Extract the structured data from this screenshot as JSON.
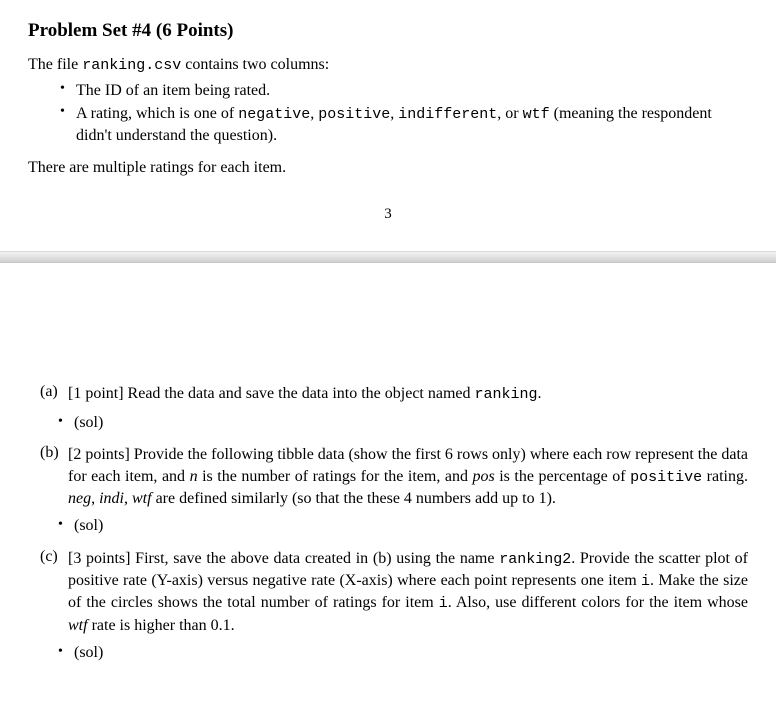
{
  "header": {
    "title_prefix": "Problem Set #4 (",
    "points": "6 Points",
    "title_suffix": ")"
  },
  "intro": {
    "line1_a": "The file ",
    "line1_code": "ranking.csv",
    "line1_b": " contains two columns:",
    "bullet1": "The ID of an item being rated.",
    "bullet2_a": "A rating, which is one of ",
    "bullet2_code1": "negative",
    "bullet2_sep1": ", ",
    "bullet2_code2": "positive",
    "bullet2_sep2": ", ",
    "bullet2_code3": "indifferent",
    "bullet2_sep3": ", or ",
    "bullet2_code4": "wtf",
    "bullet2_b": " (meaning the respondent didn't understand the question).",
    "line2": "There are multiple ratings for each item."
  },
  "page_number": "3",
  "parts": {
    "a": {
      "label": "(a)",
      "pts": "[1 point] ",
      "text_a": "Read the data and save the data into the object named ",
      "code": "ranking",
      "text_b": ".",
      "sol": "(sol)"
    },
    "b": {
      "label": "(b)",
      "pts": "[2 points] ",
      "text_a": "Provide the following tibble data (show the first 6 rows only) where each row represent the data for each item, and ",
      "ital_n": "n",
      "text_b": " is the number of ratings for the item, and ",
      "ital_pos": "pos",
      "text_c": " is the percentage of ",
      "code_pos": "positive",
      "text_d": " rating. ",
      "ital_neg": "neg",
      "sep1": ", ",
      "ital_indi": "indi",
      "sep2": ", ",
      "ital_wtf": "wtf",
      "text_e": " are defined similarly (so that the these 4 numbers add up to 1).",
      "sol": "(sol)"
    },
    "c": {
      "label": "(c)",
      "pts": "[3 points] ",
      "text_a": "First, save the above data created in (b) using the name ",
      "code_r2": "ranking2",
      "text_b": ". Provide the scatter plot of positive rate (Y-axis) versus negative rate (X-axis) where each point represents one item ",
      "code_i1": "i",
      "text_c": ". Make the size of the circles shows the total number of ratings for item ",
      "code_i2": "i",
      "text_d": ". Also, use different colors for the item whose ",
      "ital_wtf": "wtf",
      "text_e": " rate is higher than 0.1.",
      "sol": "(sol)"
    }
  }
}
